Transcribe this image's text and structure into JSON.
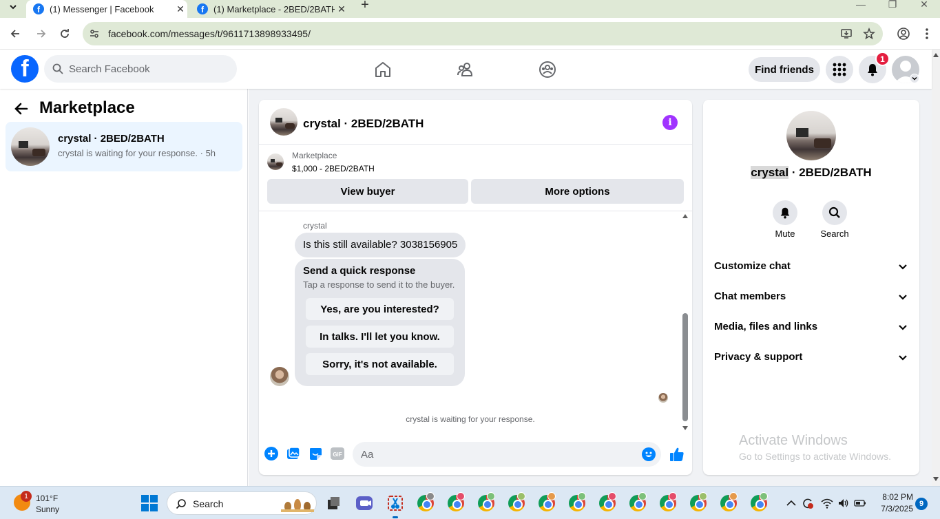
{
  "browser": {
    "tabs": [
      {
        "title": "(1) Messenger | Facebook",
        "active": true
      },
      {
        "title": "(1) Marketplace - 2BED/2BATH",
        "active": false
      }
    ],
    "new_tab": "+",
    "url": "facebook.com/messages/t/9611713898933495/"
  },
  "header": {
    "logo": "f",
    "search_placeholder": "Search Facebook",
    "find_friends": "Find friends",
    "notification_count": "1"
  },
  "left_panel": {
    "title": "Marketplace",
    "conversations": [
      {
        "name": "crystal · 2BED/2BATH",
        "preview": "crystal is waiting for your response. · 5h"
      }
    ]
  },
  "chat": {
    "title": "crystal · 2BED/2BATH",
    "listing": {
      "source": "Marketplace",
      "price_title": "$1,000 - 2BED/2BATH",
      "view_buyer": "View buyer",
      "more_options": "More options"
    },
    "sender": "crystal",
    "message": "Is this still available? 3038156905",
    "quick_response": {
      "title": "Send a quick response",
      "subtitle": "Tap a response to send it to the buyer.",
      "options": [
        "Yes, are you interested?",
        "In talks. I'll let you know.",
        "Sorry, it's not available."
      ]
    },
    "waiting": "crystal is waiting for your response.",
    "composer_placeholder": "Aa"
  },
  "right_panel": {
    "name_highlight": "crystal",
    "name_rest": " · 2BED/2BATH",
    "actions": [
      {
        "label": "Mute"
      },
      {
        "label": "Search"
      }
    ],
    "sections": [
      "Customize chat",
      "Chat members",
      "Media, files and links",
      "Privacy & support"
    ]
  },
  "watermark": {
    "line1": "Activate Windows",
    "line2": "Go to Settings to activate Windows."
  },
  "taskbar": {
    "weather_badge": "1",
    "temperature": "101°F",
    "condition": "Sunny",
    "search_label": "Search",
    "time": "8:02 PM",
    "date": "7/3/2025",
    "notification_count": "9"
  },
  "colors": {
    "facebook_blue": "#0866ff",
    "messenger_blue": "#0084ff",
    "info_purple": "#a033ff",
    "badge_red": "#e41e3f",
    "selected_conversation_bg": "#ebf5ff"
  }
}
